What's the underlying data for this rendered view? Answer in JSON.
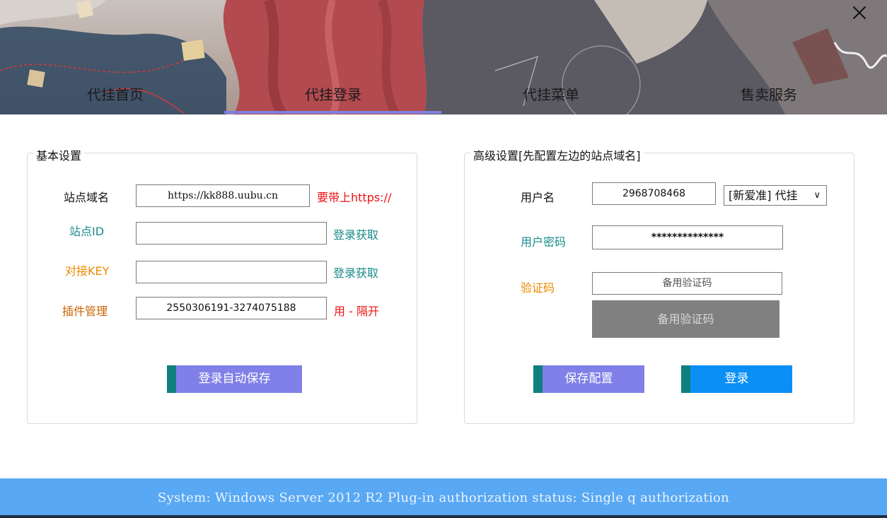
{
  "header": {
    "tabs": [
      {
        "label": "代挂首页"
      },
      {
        "label": "代挂登录"
      },
      {
        "label": "代挂菜单"
      },
      {
        "label": "售卖服务"
      }
    ],
    "active_tab_index": 1
  },
  "basic": {
    "title": "基本设置",
    "site_domain_label": "站点域名",
    "site_domain_value": "https://kk888.uubu.cn",
    "site_domain_hint": "要带上https://",
    "site_id_label": "站点ID",
    "site_id_value": "",
    "site_id_hint": "登录获取",
    "key_label": "对接KEY",
    "key_value": "",
    "key_hint": "登录获取",
    "plugin_label": "插件管理",
    "plugin_value": "2550306191-3274075188",
    "plugin_hint": "用 - 隔开",
    "save_button": "登录自动保存"
  },
  "advanced": {
    "title": "高级设置[先配置左边的站点域名]",
    "username_label": "用户名",
    "username_value": "2968708468",
    "mode_select": "[新爱准] 代挂",
    "password_label": "用户密码",
    "password_value": "**************",
    "captcha_label": "验证码",
    "captcha_placeholder": "备用验证码",
    "captcha_button": "备用验证码",
    "save_config_button": "保存配置",
    "login_button": "登录"
  },
  "status_bar": {
    "text": "System:  Windows Server 2012 R2  Plug-in authorization status:  Single q authorization"
  },
  "colors": {
    "accent_purple": "#8080e8",
    "accent_blue": "#0a8ff5",
    "teal_bar": "#0f7f7f",
    "status_bg": "#59a8f4",
    "teal_text": "#1a8a8a",
    "orange_text": "#ee8800",
    "red_text": "#ee1111",
    "disabled_gray": "#808080"
  }
}
